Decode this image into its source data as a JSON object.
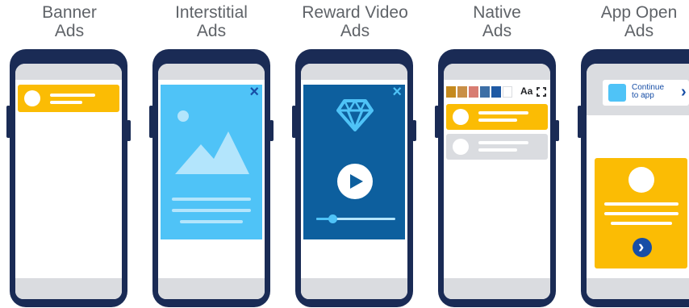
{
  "titles": {
    "banner": [
      "Banner",
      "Ads"
    ],
    "interstitial": [
      "Interstitial",
      "Ads"
    ],
    "reward": [
      "Reward Video",
      "Ads"
    ],
    "native": [
      "Native",
      "Ads"
    ],
    "appopen": [
      "App Open",
      "Ads"
    ]
  },
  "icons": {
    "interstitial_close": "×",
    "reward_close": "×",
    "native_text_style": "Aa",
    "appopen_chevron": "›",
    "appopen_arrow": "›"
  },
  "appopen": {
    "continue_label_1": "Continue",
    "continue_label_2": "to app"
  },
  "native_swatches": [
    "#c58a1e",
    "#c98f46",
    "#d87d72",
    "#3d6fa6",
    "#1f5aa4",
    "#ffffff"
  ],
  "colors": {
    "phone": "#1a2b55",
    "bar": "#dadce0",
    "yellow": "#fbbc04",
    "light_blue": "#4fc3f7",
    "dark_blue": "#0d5f9e",
    "navy": "#174ea6"
  }
}
